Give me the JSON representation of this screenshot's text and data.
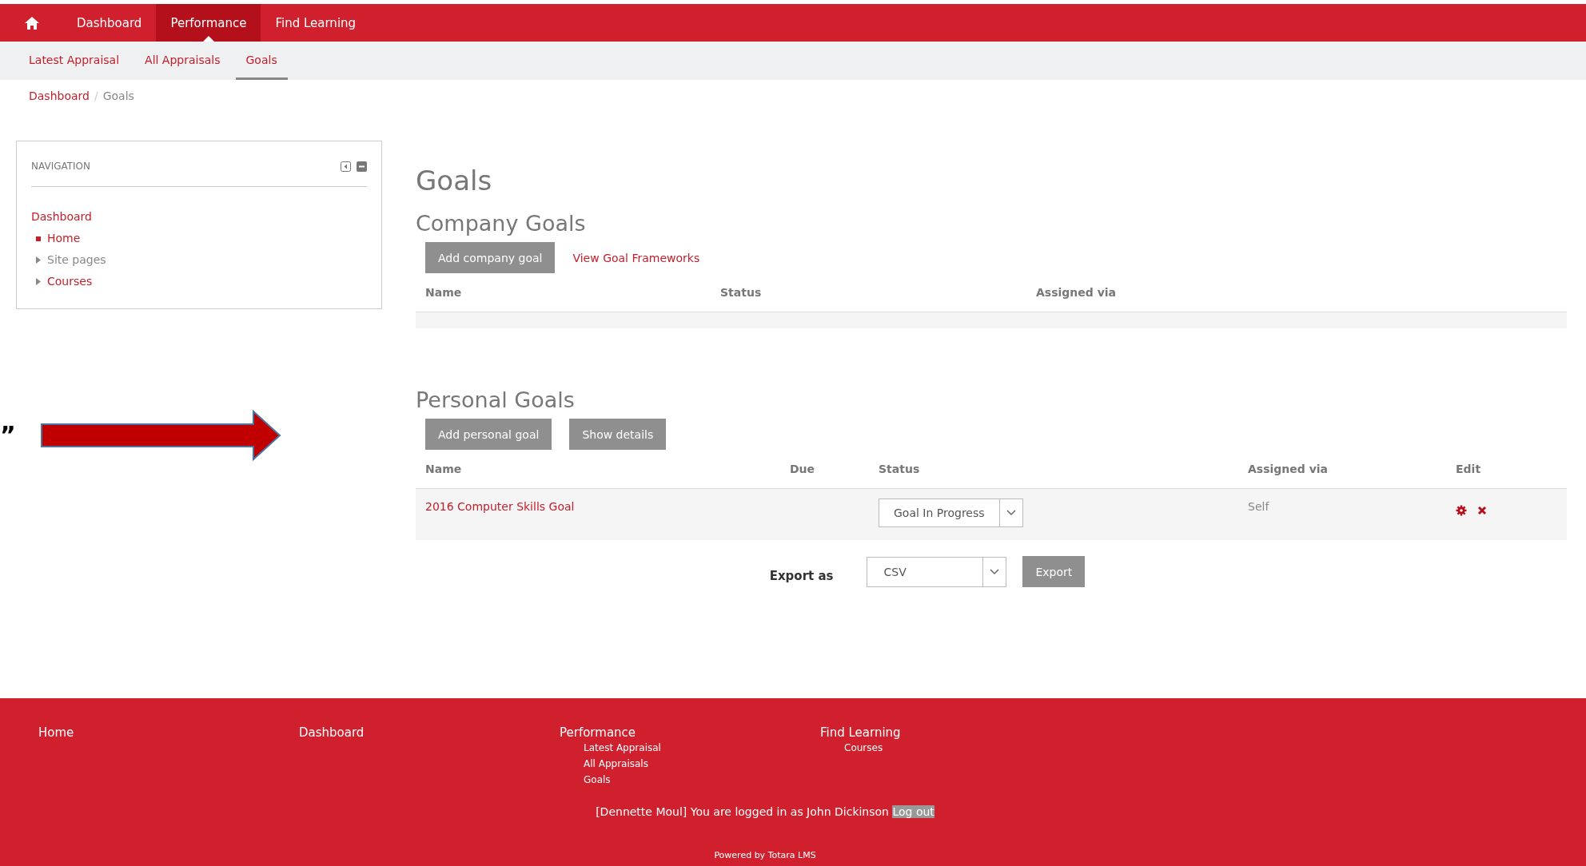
{
  "top_nav": [
    {
      "label": "Dashboard",
      "selected": false
    },
    {
      "label": "Performance",
      "selected": true
    },
    {
      "label": "Find Learning",
      "selected": false
    }
  ],
  "sub_nav": [
    {
      "label": "Latest Appraisal",
      "selected": false
    },
    {
      "label": "All Appraisals",
      "selected": false
    },
    {
      "label": "Goals",
      "selected": true
    }
  ],
  "breadcrumb": [
    {
      "label": "Dashboard",
      "kind": "link"
    },
    {
      "label": "/",
      "kind": "separator"
    },
    {
      "label": "Goals",
      "kind": "current"
    }
  ],
  "navigation_block": {
    "title": "NAVIGATION",
    "items": [
      {
        "label": "Dashboard",
        "kind": "link"
      },
      {
        "label": "Home",
        "kind": "page",
        "linked": true
      },
      {
        "label": "Site pages",
        "kind": "branch",
        "linked": false,
        "expanded": false
      },
      {
        "label": "Courses",
        "kind": "branch",
        "linked": true,
        "expanded": false
      }
    ]
  },
  "annotation": {
    "mark": "”"
  },
  "page_title": "Goals",
  "company_goals": {
    "title": "Company Goals",
    "button": "Add company goal",
    "link": "View Goal Frameworks",
    "columns": [
      "Name",
      "Status",
      "Assigned via"
    ]
  },
  "personal_goals": {
    "title": "Personal Goals",
    "buttons": [
      "Add personal goal",
      "Show details"
    ],
    "columns": [
      "Name",
      "Due",
      "Status",
      "Assigned via",
      "Edit"
    ],
    "rows": [
      {
        "name": "2016 Computer Skills Goal",
        "status": "Goal In Progress",
        "assigned_via": "Self"
      }
    ]
  },
  "export": {
    "label": "Export as",
    "format": "CSV",
    "button": "Export"
  },
  "footer": {
    "columns": [
      {
        "label": "Home"
      },
      {
        "label": "Dashboard"
      },
      {
        "label": "Performance",
        "children": [
          "Latest Appraisal",
          "All Appraisals",
          "Goals"
        ]
      },
      {
        "label": "Find Learning",
        "children": [
          "Courses"
        ]
      }
    ],
    "login_text": "[Dennette Moul] You are logged in as John Dickinson",
    "logout": "Log out",
    "powered": "Powered by Totara LMS"
  }
}
